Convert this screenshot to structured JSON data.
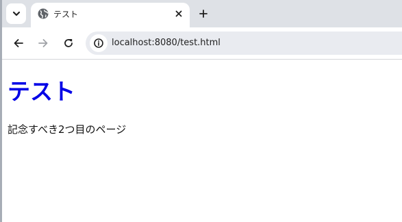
{
  "tab": {
    "title": "テスト",
    "favicon": "globe-icon"
  },
  "toolbar": {
    "url": "localhost:8080/test.html"
  },
  "page": {
    "heading": "テスト",
    "paragraph": "記念すべき2つ目のページ"
  },
  "colors": {
    "heading": "#0000e6",
    "tabstrip": "#dee1e6",
    "omnibox": "#e9ebf0"
  }
}
